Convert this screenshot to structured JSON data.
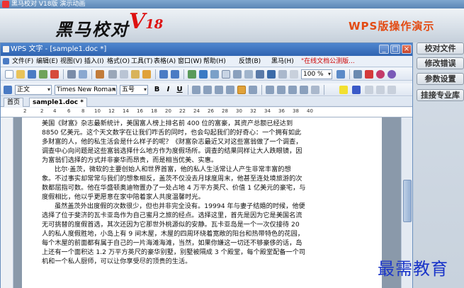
{
  "titlebar": {
    "title": "黑马校对 V18版 演示动画"
  },
  "banner": {
    "logo": "黑马校对",
    "logo_v": "V",
    "logo_num": "18",
    "demo_title": "WPS版操作演示"
  },
  "side_buttons": [
    "校对文件",
    "修改错误",
    "参数设置",
    "挂接专业库"
  ],
  "wps": {
    "title": "WPS 文字 - [sample1.doc *]",
    "window_buttons": [
      "_",
      "□",
      "×"
    ],
    "menu": [
      "文件(F)",
      "编辑(E)",
      "视图(V)",
      "插入(I)",
      "格式(O)",
      "工具(T)",
      "表格(A)",
      "窗口(W)",
      "帮助(H)",
      "反馈(B)",
      "黑马(H)",
      "\"在线文档公测版..."
    ],
    "zoom": "100 %",
    "style": "正文",
    "font": "Times New Roman",
    "size": "五号",
    "format_buttons": [
      "B",
      "I",
      "U"
    ],
    "tabs": [
      "首页",
      "sample1.doc *"
    ]
  },
  "ruler_numbers": [
    "2",
    "2",
    "4",
    "6",
    "8",
    "10",
    "12",
    "14",
    "16",
    "18",
    "20",
    "22",
    "24",
    "26",
    "28",
    "30",
    "32",
    "34",
    "36",
    "38",
    "40"
  ],
  "document_lines": [
    "美国《财富》杂志最新统计，美国富人榜上排名前 400 位的富豪，其资产总额已经达到",
    "8850 亿美元。这个天文数字在让我们咋舌的同时，也会勾起我们的好奇心：一个拥有如此",
    "多财富的人，他的私生活会是什么样子的呢？《财富杂志最近又对这些富翁做了一个调查，",
    "调查中心向问题是这些富翁选择什么地方作为度假场所。调查的结果同样让大人跌眼镜，因",
    "为富翁们选择的方式并非豪华而昂贵，而是相当优美、实惠。",
    "比尔·盖茨，微软的主要创始人和世界首富，他的私人生活常让人产生非常丰富的想",
    "象。不过事实却常常与我们的想象相反，盖茨不仅没去月球度周末，他甚至连处境旅游的次",
    "数都屈指可数。他在华盛顿奥迪物置办了一处占地 4 万平方英尺、价值 1 亿美元的豪宅，与",
    "度假相比，他以乎更愿意在家中陪着家人共度温馨时光。",
    "虽然盖茨外出度假的次数很少，但也并非完全没有。19994 年与妻子结婚的时候，他便",
    "选择了位于斐济的瓦卡亚岛作为自己蜜月之旅的经点。选择这里，首先是因为它是美国名流",
    "无可挑替的度假首选，其次还因为它那世外桃源似的安静。瓦卡亚岛是一个一次仅接待 20",
    "人的私人度假胜地，小岛上有 9 间木屋，木屋的四周环绕着宽敞的阳台和热带特色的花园，",
    "每个木屋的前面都有属于自己的一片海滩海滩，当然，如果你嫌这一切还不够豪侈的话，岛",
    "上还有一个面积达 1.2 万平方英尺的豪华别墅，别墅被隔成 3 个殿堂，每个殿堂配备一个司",
    "机和一个私人厨师，可以让你享受尽的顶贵的生活。"
  ],
  "watermark": "最需教育"
}
